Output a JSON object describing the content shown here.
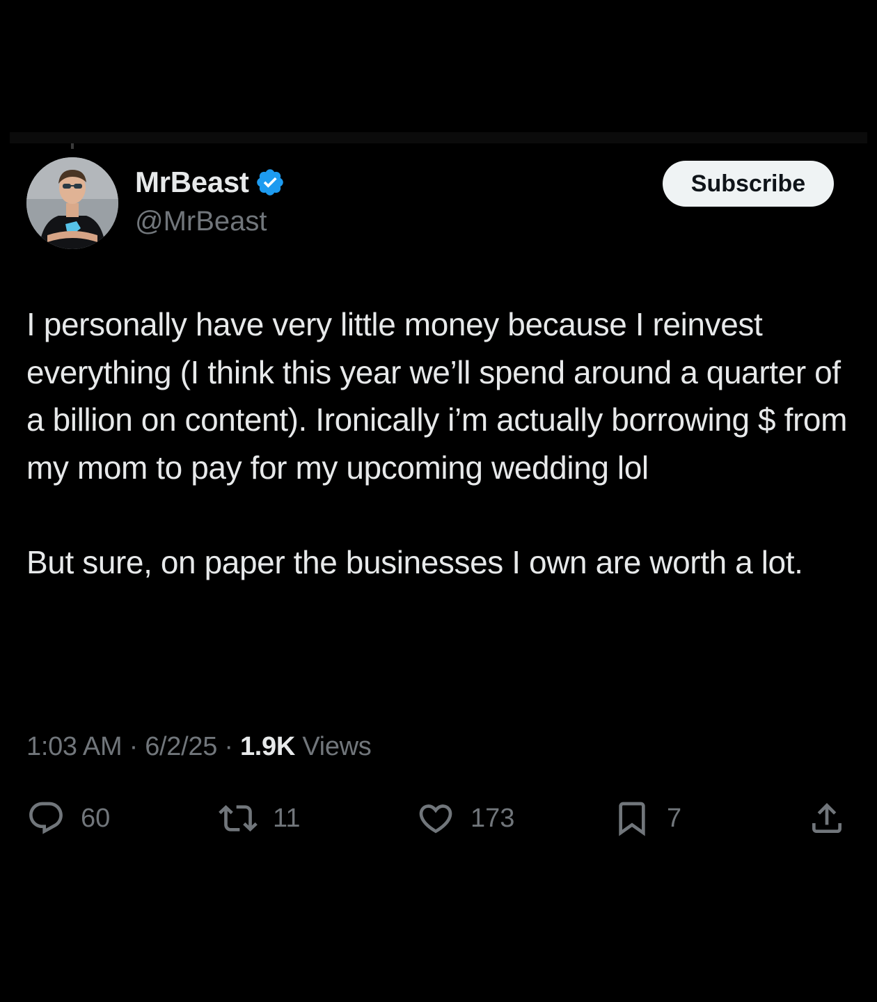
{
  "author": {
    "display_name": "MrBeast",
    "handle": "@MrBeast",
    "verified": true
  },
  "subscribe_label": "Subscribe",
  "tweet": {
    "paragraphs": [
      "I personally have very little money because I reinvest everything (I think this year we’ll spend around a quarter of a billion on content). Ironically i’m actually borrowing $ from my mom to pay for my upcoming wedding lol",
      "But sure, on paper the businesses I own are worth a lot."
    ]
  },
  "meta": {
    "time": "1:03 AM",
    "separator": "·",
    "date": "6/2/25",
    "views_count": "1.9K",
    "views_label": "Views"
  },
  "actions": {
    "replies": "60",
    "reposts": "11",
    "likes": "173",
    "bookmarks": "7"
  },
  "colors": {
    "background": "#000000",
    "text_primary": "#e7e9ea",
    "text_secondary": "#71767b",
    "verified_badge": "#1d9bf0",
    "subscribe_bg": "#eff3f4"
  },
  "icons": [
    "verified-badge-icon",
    "reply-icon",
    "repost-icon",
    "like-icon",
    "bookmark-icon",
    "share-icon"
  ]
}
